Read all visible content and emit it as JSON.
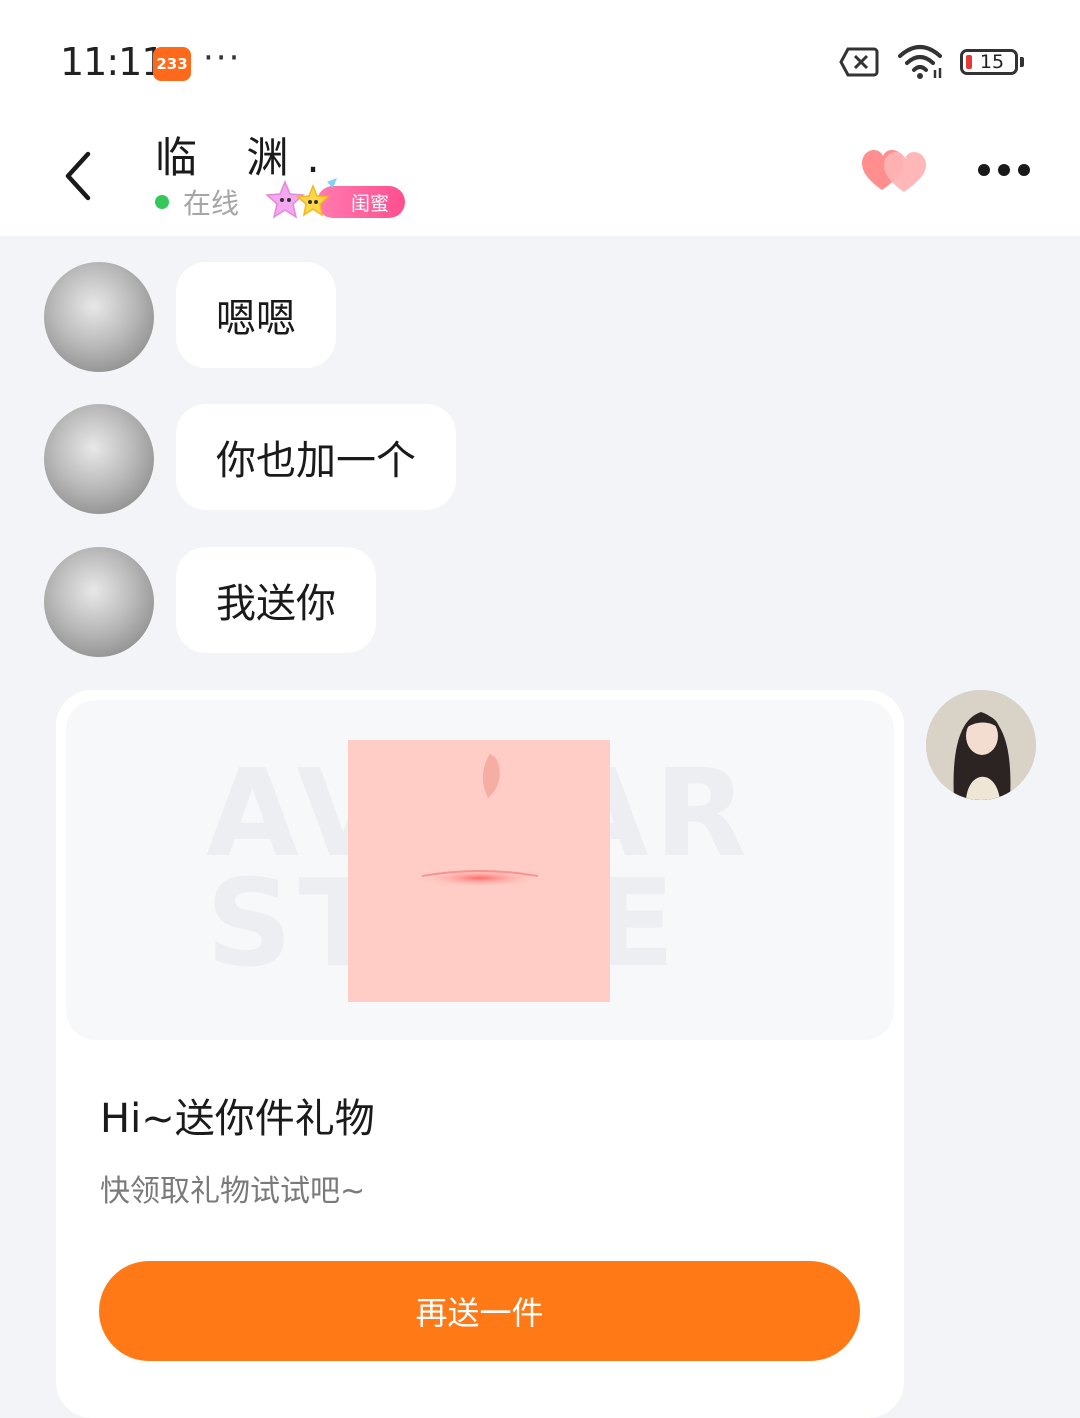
{
  "status_bar": {
    "time": "11:11",
    "app_badge": "233",
    "more": "···",
    "battery_level": "15",
    "icons": [
      "sim-off-icon",
      "wifi-icon",
      "battery-icon"
    ]
  },
  "header": {
    "contact_name": "临 渊.",
    "online_text": "在线",
    "relation_label": "闺蜜",
    "accent_color": "#ff7a17",
    "online_color": "#34c759"
  },
  "messages": [
    {
      "sender": "them",
      "text": "嗯嗯"
    },
    {
      "sender": "them",
      "text": "你也加一个"
    },
    {
      "sender": "them",
      "text": "我送你"
    }
  ],
  "gift_card": {
    "watermark": "AVATAR STORE",
    "title": "Hi~送你件礼物",
    "subtitle": "快领取礼物试试吧~",
    "button_label": "再送一件"
  }
}
